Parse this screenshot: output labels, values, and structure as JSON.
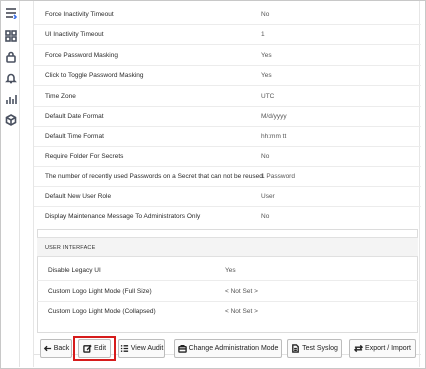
{
  "settings": [
    {
      "label": "Force Inactivity Timeout",
      "value": "No"
    },
    {
      "label": "UI Inactivity Timeout",
      "value": "1"
    },
    {
      "label": "Force Password Masking",
      "value": "Yes"
    },
    {
      "label": "Click to Toggle Password Masking",
      "value": "Yes"
    },
    {
      "label": "Time Zone",
      "value": "UTC"
    },
    {
      "label": "Default Date Format",
      "value": "M/d/yyyy"
    },
    {
      "label": "Default Time Format",
      "value": "hh:mm tt"
    },
    {
      "label": "Require Folder For Secrets",
      "value": "No"
    },
    {
      "label": "The number of recently used Passwords on a Secret that can not be reused.",
      "value": "1 Password"
    },
    {
      "label": "Default New User Role",
      "value": "User"
    },
    {
      "label": "Display Maintenance Message To Administrators Only",
      "value": "No"
    }
  ],
  "ui_section": {
    "title": "USER INTERFACE",
    "rows": [
      {
        "label": "Disable Legacy UI",
        "value": "Yes"
      },
      {
        "label": "Custom Logo Light Mode (Full Size)",
        "value": "< Not Set >"
      },
      {
        "label": "Custom Logo Light Mode (Collapsed)",
        "value": "< Not Set >"
      }
    ]
  },
  "toolbar": {
    "back": "Back",
    "edit": "Edit",
    "view_audit": "View Audit",
    "change_admin_mode": "Change Administration Mode",
    "test_syslog": "Test Syslog",
    "export_import": "Export / Import"
  },
  "sidebar_icons": [
    "menu-icon",
    "dashboard-icon",
    "lock-icon",
    "bell-icon",
    "reports-icon",
    "package-icon"
  ],
  "colors": {
    "highlight": "#d61c1c"
  }
}
